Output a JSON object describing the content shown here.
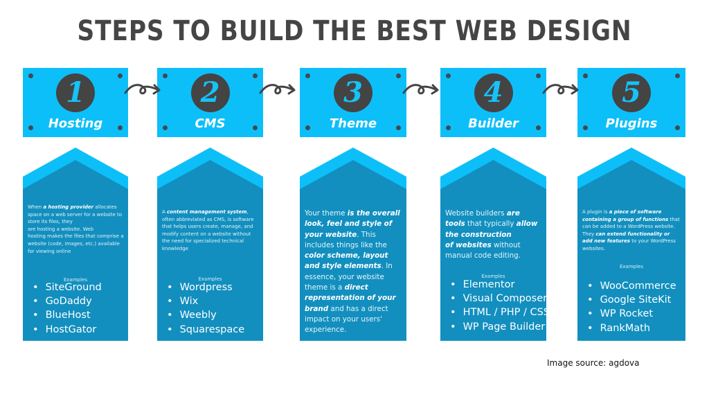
{
  "title": "STEPS TO BUILD THE BEST WEB DESIGN",
  "colors": {
    "light_blue": "#0dbff8",
    "dark_blue": "#128fbf",
    "circle": "#444444",
    "title": "#454545"
  },
  "steps": [
    {
      "number": "1",
      "label": "Hosting",
      "size": "small",
      "description": [
        {
          "t": "When "
        },
        {
          "t": "a hosting provider",
          "b": true
        },
        {
          "t": " allocates space on a web server for a website to store its files, they"
        },
        {
          "br": true
        },
        {
          "t": "are hosting a website. Web"
        },
        {
          "br": true
        },
        {
          "t": "hosting makes the files that comprise a website (code, images, etc.) available for viewing online"
        }
      ],
      "examples_label": "Examples",
      "examples": [
        "SiteGround",
        "GoDaddy",
        "BlueHost",
        "HostGator"
      ]
    },
    {
      "number": "2",
      "label": "CMS",
      "size": "small",
      "description": [
        {
          "t": "A "
        },
        {
          "t": "content management system",
          "b": true
        },
        {
          "t": ", often abbreviated as CMS, is software that helps users create, manage, and modify content on a website without the need for specialized technical knowledge"
        }
      ],
      "examples_label": "Examples",
      "examples": [
        "Wordpress",
        "Wix",
        "Weebly",
        "Squarespace"
      ]
    },
    {
      "number": "3",
      "label": "Theme",
      "size": "big",
      "description": [
        {
          "t": "Your theme "
        },
        {
          "t": "is the overall look, feel and style of your website",
          "b": true
        },
        {
          "t": ". This includes things like the "
        },
        {
          "t": "color scheme, layout and style elements",
          "b": true
        },
        {
          "t": ". In essence, your website theme is a "
        },
        {
          "t": "direct representation of your brand",
          "b": true
        },
        {
          "t": " and has a direct impact on your users' experience."
        }
      ],
      "examples_label": "",
      "examples": []
    },
    {
      "number": "4",
      "label": "Builder",
      "size": "big",
      "description": [
        {
          "t": "Website builders "
        },
        {
          "t": "are tools",
          "b": true
        },
        {
          "t": " that typically "
        },
        {
          "t": "allow the construction",
          "b": true
        },
        {
          "br": true
        },
        {
          "t": "of websites",
          "b": true
        },
        {
          "t": " without manual code editing."
        }
      ],
      "examples_label": "Examples",
      "examples": [
        "Elementor",
        "Visual Composer",
        "HTML / PHP / CSS",
        "WP Page Builder"
      ]
    },
    {
      "number": "5",
      "label": "Plugins",
      "size": "small",
      "description": [
        {
          "t": "A plugin is "
        },
        {
          "t": "a piece of software containing a group of functions",
          "b": true
        },
        {
          "t": " that can be added to a WordPress website. They "
        },
        {
          "t": "can extend functionality or add new features",
          "b": true
        },
        {
          "t": " to your WordPress websites."
        }
      ],
      "examples_label": "Examples",
      "examples": [
        "WooCommerce",
        "Google SiteKit",
        "WP Rocket",
        "RankMath"
      ]
    }
  ],
  "source": "Image source: agdova"
}
